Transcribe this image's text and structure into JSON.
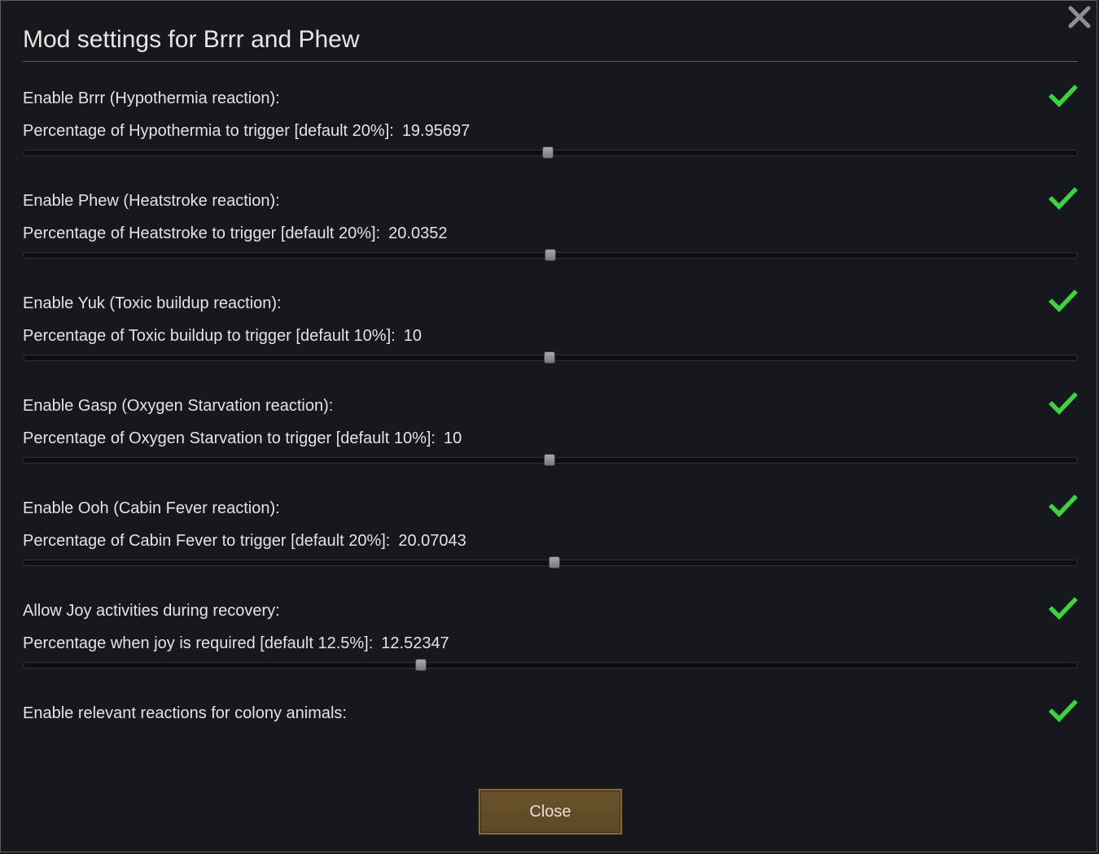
{
  "window": {
    "title": "Mod settings for Brrr and Phew",
    "close_icon": "close-x-icon"
  },
  "settings": [
    {
      "toggle_label": "Enable Brrr (Hypothermia reaction):",
      "checked": true,
      "slider_label": "Percentage of Hypothermia to trigger [default 20%]:",
      "slider_value": "19.95697",
      "slider_fraction": 0.4977
    },
    {
      "toggle_label": "Enable Phew (Heatstroke reaction):",
      "checked": true,
      "slider_label": "Percentage of Heatstroke to trigger [default 20%]:",
      "slider_value": "20.0352",
      "slider_fraction": 0.5003
    },
    {
      "toggle_label": "Enable Yuk (Toxic buildup reaction):",
      "checked": true,
      "slider_label": "Percentage of Toxic buildup to trigger [default 10%]:",
      "slider_value": "10",
      "slider_fraction": 0.4996
    },
    {
      "toggle_label": "Enable Gasp (Oxygen Starvation reaction):",
      "checked": true,
      "slider_label": "Percentage of Oxygen Starvation to trigger [default 10%]:",
      "slider_value": "10",
      "slider_fraction": 0.4996
    },
    {
      "toggle_label": "Enable Ooh (Cabin Fever reaction):",
      "checked": true,
      "slider_label": "Percentage of Cabin Fever to trigger [default 20%]:",
      "slider_value": "20.07043",
      "slider_fraction": 0.5035
    },
    {
      "toggle_label": "Allow Joy activities during recovery:",
      "checked": true,
      "slider_label": "Percentage when joy is required [default 12.5%]:",
      "slider_value": "12.52347",
      "slider_fraction": 0.3773
    },
    {
      "toggle_label": "Enable relevant reactions for colony animals:",
      "checked": true
    }
  ],
  "footer": {
    "close_label": "Close"
  },
  "colors": {
    "checkmark": "#3fd23f",
    "button_brown": "#6b542c",
    "window_bg": "#15191d"
  }
}
